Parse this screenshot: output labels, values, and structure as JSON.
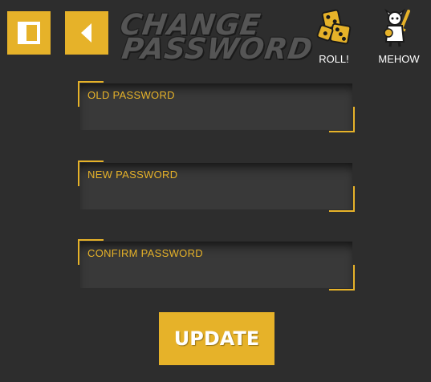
{
  "header": {
    "title_line1": "CHANGE",
    "title_line2": "PASSWORD",
    "panel_icon": "sidebar-panel-icon",
    "back_icon": "back-arrow-icon",
    "tools": [
      {
        "label": "ROLL!",
        "icon": "dice-icon"
      },
      {
        "label": "MEHOW",
        "icon": "knight-character-icon"
      }
    ]
  },
  "form": {
    "fields": [
      {
        "label": "OLD PASSWORD",
        "value": ""
      },
      {
        "label": "NEW PASSWORD",
        "value": ""
      },
      {
        "label": "CONFIRM PASSWORD",
        "value": ""
      }
    ],
    "submit_label": "UPDATE"
  },
  "colors": {
    "accent": "#e6b229",
    "background": "#2d2d2d",
    "field_bg": "#393939",
    "text": "#ffffff"
  }
}
